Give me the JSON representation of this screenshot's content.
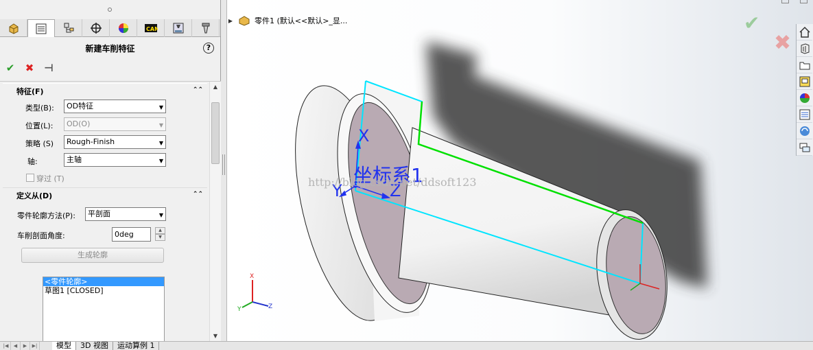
{
  "property_manager": {
    "title": "新建车削特征",
    "tabs": [
      "feature-manager-icon",
      "property-manager-icon",
      "configuration-manager-icon",
      "dimxpert-icon",
      "display-manager-icon",
      "cam-manager-icon",
      "cam-operation-icon",
      "cam-tools-icon"
    ],
    "actions": {
      "ok": "✔",
      "cancel": "✖",
      "pin": "⊣"
    },
    "feature_group": {
      "header": "特征(F)",
      "type_label": "类型(B):",
      "type_value": "OD特征",
      "position_label": "位置(L):",
      "position_value": "OD(O)",
      "strategy_label": "策略 (S)",
      "strategy_value": "Rough-Finish",
      "axis_label": "轴:",
      "axis_value": "主轴",
      "through_label": "穿过 (T)"
    },
    "define_from_group": {
      "header": "定义从(D)",
      "method_label": "零件轮廓方法(P):",
      "method_value": "平剖面",
      "angle_label": "车削剖面角度:",
      "angle_value": "0deg",
      "generate_button": "生成轮廓",
      "list_items": [
        "<零件轮廓>",
        "草图1 [CLOSED]"
      ]
    }
  },
  "bottom_tabs": [
    "模型",
    "3D 视图",
    "运动算例 1"
  ],
  "viewport": {
    "tree_node": "零件1  (默认<<默认>_显...",
    "coord_label": "坐标系1",
    "axis_labels": {
      "x": "X",
      "y": "Y",
      "z": "Z"
    },
    "watermark": "http://blog.csdn.net/ddsoft123",
    "triad_labels": {
      "x": "X",
      "y": "Y",
      "z": "Z"
    }
  },
  "task_pane": [
    "home-icon",
    "design-library-icon",
    "file-explorer-icon",
    "view-palette-icon",
    "appearances-icon",
    "custom-properties-icon",
    "forum-icon",
    "chat-icon"
  ],
  "colors": {
    "part_body": "#f2f2f2",
    "part_face": "#b9aab3",
    "outline_cyan": "#00e5ff",
    "outline_green": "#00e000",
    "coord_blue": "#2233ee"
  }
}
